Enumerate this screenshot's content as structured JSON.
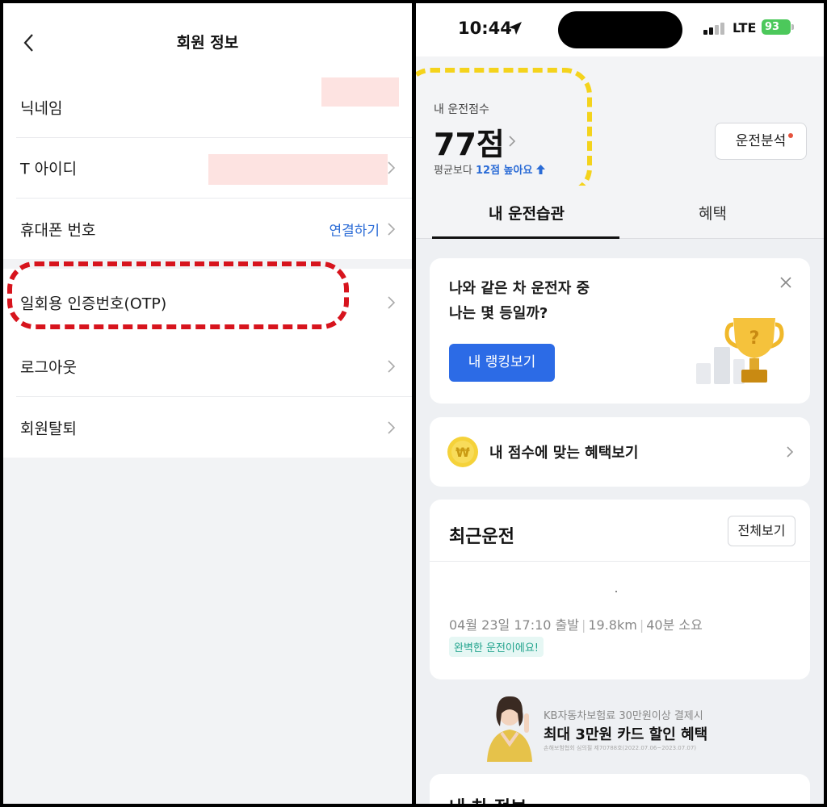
{
  "left": {
    "title": "회원 정보",
    "rows": [
      {
        "label": "닉네임"
      },
      {
        "label": "T 아이디"
      },
      {
        "label": "휴대폰 번호",
        "action": "연결하기"
      }
    ],
    "otp_label": "일회용 인증번호(OTP)",
    "rows2": [
      {
        "label": "로그아웃"
      },
      {
        "label": "회원탈퇴"
      }
    ]
  },
  "right": {
    "status": {
      "time": "10:44",
      "network": "LTE",
      "battery": "93"
    },
    "score": {
      "label": "내 운전점수",
      "value": "77점",
      "sub_prefix": "평균보다",
      "sub_highlight": "12점 높아요"
    },
    "analysis_button": "운전분석",
    "tabs": [
      "내 운전습관",
      "혜택"
    ],
    "ranking_card": {
      "line1": "나와 같은 차 운전자 중",
      "line2": "나는 몇 등일까?",
      "button": "내 랭킹보기"
    },
    "benefit_card": {
      "title": "내 점수에 맞는 혜택보기"
    },
    "recent": {
      "title": "최근운전",
      "view_all": "전체보기",
      "date": "04월 23일 17:10 출발",
      "distance": "19.8km",
      "duration": "40분 소요",
      "badge": "완벽한 운전이에요!"
    },
    "ad": {
      "sub": "KB자동차보험료 30만원이상 결제시",
      "title": "최대 3만원 카드 할인 혜택",
      "fine": "손해보험협회 심의필 제70788호(2022.07.06~2023.07.07)"
    },
    "car_info_title": "내 차 정보"
  },
  "colors": {
    "accent_blue": "#2c6be6",
    "link_blue": "#2a6bd6",
    "red_highlight": "#d7141d",
    "yellow_highlight": "#f4d31c"
  }
}
